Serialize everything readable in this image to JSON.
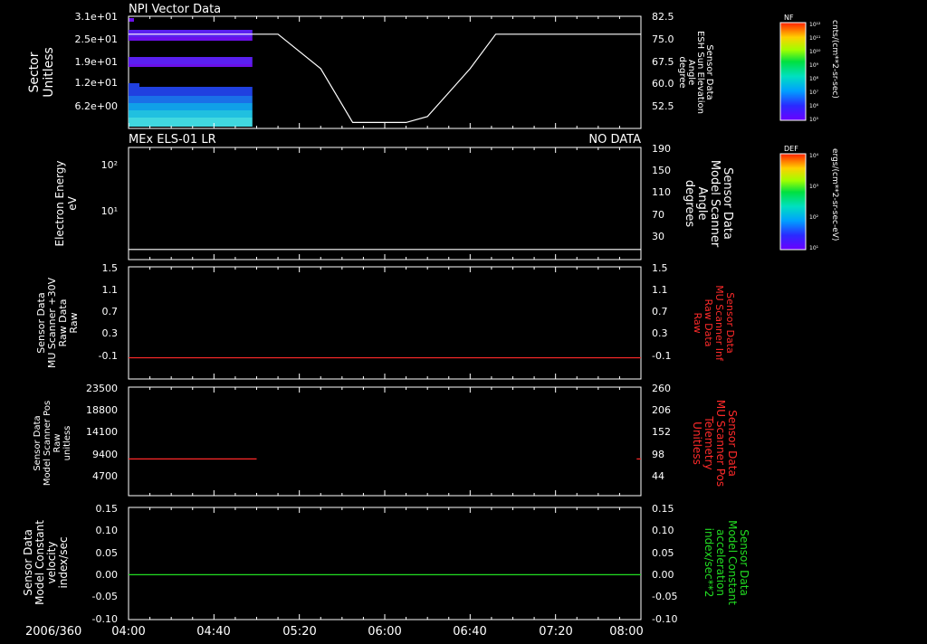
{
  "date_label": "2006/360",
  "time_ticks": [
    "04:00",
    "04:40",
    "05:20",
    "06:00",
    "06:40",
    "07:20",
    "08:00"
  ],
  "colors": {
    "white": "#ffffff",
    "red": "#ff2a2a",
    "green": "#22dd22"
  },
  "colorbars": [
    {
      "title": "NF",
      "units": "cnts/(cm**2-sr-sec)",
      "ticks": [
        "10¹²",
        "10¹¹",
        "10¹⁰",
        "10⁹",
        "10⁸",
        "10⁷",
        "10⁶",
        "10⁵"
      ]
    },
    {
      "title": "DEF",
      "units": "ergs/(cm**2-sr-sec-eV)",
      "ticks": [
        "10⁴",
        "10³",
        "10²",
        "10¹"
      ]
    }
  ],
  "chart_data": [
    {
      "type": "heatmap",
      "title": "NPI Vector Data",
      "left_ylabel": [
        "Sector",
        "Unitless"
      ],
      "left_ticks": [
        "3.1e+01",
        "2.5e+01",
        "1.9e+01",
        "1.2e+01",
        "6.2e+00"
      ],
      "left_ylim": [
        0,
        31
      ],
      "right_ylabel": [
        "Sensor Data",
        "ESH Sun Elevation",
        "Angle",
        "degree"
      ],
      "right_ticks": [
        "82.5",
        "75.0",
        "67.5",
        "60.0",
        "52.5"
      ],
      "right_ylim": [
        45,
        82.5
      ],
      "heatmap_x_range": [
        "04:00",
        "04:58"
      ],
      "line_series": {
        "name": "ESH Sun Elevation Angle",
        "x": [
          "04:00",
          "05:10",
          "05:30",
          "05:45",
          "06:10",
          "06:20",
          "06:40",
          "06:52",
          "08:00"
        ],
        "y": [
          76.5,
          76.5,
          65,
          47,
          47,
          49,
          65,
          76.5,
          76.5
        ]
      }
    },
    {
      "type": "line",
      "title": "MEx ELS-01 LR",
      "status": "NO DATA",
      "left_ylabel": [
        "Electron Energy",
        "eV"
      ],
      "left_ticks": [
        "10²",
        "10¹"
      ],
      "right_ylabel": [
        "Sensor Data",
        "Model Scanner",
        "Angle",
        "degrees"
      ],
      "right_ticks": [
        "190",
        "150",
        "110",
        "70",
        "30"
      ],
      "right_ylim": [
        0,
        190
      ],
      "series": [
        {
          "name": "Model Scanner Angle",
          "x": [
            "04:00",
            "08:00"
          ],
          "y": [
            2,
            2
          ]
        }
      ]
    },
    {
      "type": "line",
      "left_ylabel": [
        "Sensor Data",
        "MU Scanner +30V",
        "Raw Data",
        "Raw"
      ],
      "left_ticks": [
        "1.5",
        "1.1",
        "0.7",
        "0.3",
        "-0.1"
      ],
      "ylim": [
        -0.35,
        1.5
      ],
      "right_ylabel": [
        "Sensor Data",
        "MU Scanner Inf",
        "Raw Data",
        "Raw"
      ],
      "right_ticks": [
        "1.5",
        "1.1",
        "0.7",
        "0.3",
        "-0.1"
      ],
      "series": [
        {
          "name": "MU Scanner Inf Raw Data",
          "x": [
            "04:00",
            "08:00"
          ],
          "y": [
            0.0,
            0.0
          ]
        }
      ]
    },
    {
      "type": "line",
      "left_ylabel": [
        "Sensor Data",
        "Model Scanner Pos",
        "Raw",
        "unitless"
      ],
      "left_ticks": [
        "23500",
        "18800",
        "14100",
        "9400",
        "4700"
      ],
      "left_ylim": [
        0,
        23500
      ],
      "right_ylabel": [
        "Sensor Data",
        "MU Scanner Pos",
        "Telemetry",
        "Unitless"
      ],
      "right_ticks": [
        "260",
        "206",
        "152",
        "98",
        "44"
      ],
      "right_ylim": [
        0,
        260
      ],
      "series": [
        {
          "name": "MU Scanner Pos Telemetry",
          "x": [
            "04:00",
            "05:00"
          ],
          "y": [
            88,
            88
          ]
        },
        {
          "name": "MU Scanner Pos Telemetry",
          "x": [
            "07:58",
            "08:00"
          ],
          "y": [
            88,
            88
          ]
        }
      ]
    },
    {
      "type": "line",
      "left_ylabel": [
        "Sensor Data",
        "Model Constant",
        "velocity",
        "index/sec"
      ],
      "left_ticks": [
        "0.15",
        "0.10",
        "0.05",
        "0.00",
        "-0.05",
        "-0.10"
      ],
      "ylim": [
        -0.1,
        0.15
      ],
      "right_ylabel": [
        "Sensor Data",
        "Model Constant",
        "acceleration",
        "index/sec**2"
      ],
      "right_ticks": [
        "0.15",
        "0.10",
        "0.05",
        "0.00",
        "-0.05",
        "-0.10"
      ],
      "series": [
        {
          "name": "Model Constant acceleration",
          "x": [
            "04:00",
            "08:00"
          ],
          "y": [
            0.0,
            0.0
          ]
        }
      ]
    }
  ]
}
